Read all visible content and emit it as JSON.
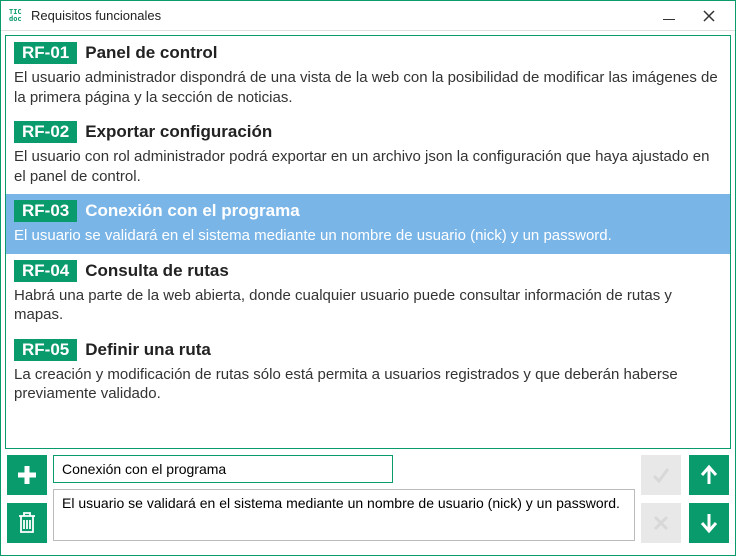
{
  "window": {
    "title": "Requisitos funcionales",
    "icon_line1": "TIC",
    "icon_line2": "doc"
  },
  "requirements": [
    {
      "code": "RF-01",
      "title": "Panel de control",
      "desc": "El usuario administrador dispondrá de una vista de la web con la posibilidad de modificar las imágenes de la primera página y la sección de noticias.",
      "selected": false
    },
    {
      "code": "RF-02",
      "title": "Exportar configuración",
      "desc": "El usuario con rol administrador podrá exportar en un archivo json la configuración que haya ajustado en el panel de control.",
      "selected": false
    },
    {
      "code": "RF-03",
      "title": "Conexión con el programa",
      "desc": "El usuario se validará en el sistema mediante un nombre de usuario (nick) y un password.",
      "selected": true
    },
    {
      "code": "RF-04",
      "title": "Consulta de rutas",
      "desc": "Habrá una parte de la web abierta, donde cualquier usuario puede consultar información de rutas y mapas.",
      "selected": false
    },
    {
      "code": "RF-05",
      "title": "Definir una ruta",
      "desc": "La creación y modificación de rutas sólo está permita a usuarios registrados y que deberán haberse previamente validado.",
      "selected": false
    }
  ],
  "editor": {
    "title_value": "Conexión con el programa",
    "desc_value": "El usuario se validará en el sistema mediante un nombre de usuario (nick) y un password."
  },
  "icons": {
    "add": "plus-icon",
    "delete": "trash-icon",
    "confirm": "check-icon",
    "cancel": "x-icon",
    "up": "arrow-up-icon",
    "down": "arrow-down-icon",
    "minimize": "minimize-icon",
    "close": "close-icon"
  },
  "colors": {
    "accent": "#0a9b6d",
    "selected_bg": "#7ab5e8"
  }
}
